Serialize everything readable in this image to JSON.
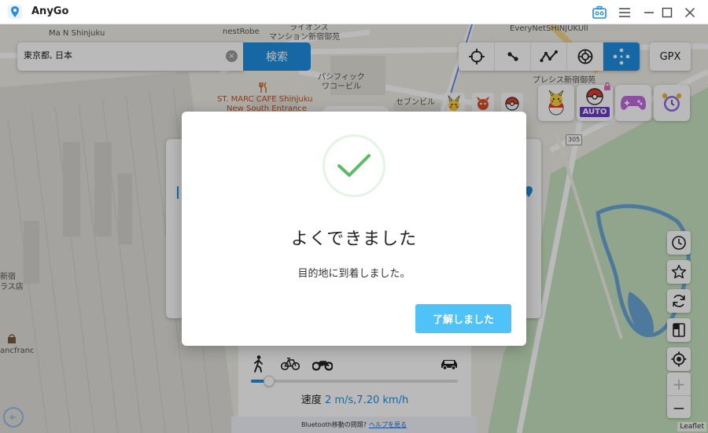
{
  "app": {
    "title": "AnyGo"
  },
  "search": {
    "value": "東京都, 日本",
    "button": "検索"
  },
  "toolbar": {
    "gpx": "GPX"
  },
  "feature_icons": {
    "auto_badge": "AUTO"
  },
  "map": {
    "labels": {
      "label_1": "Ma N Shinjuku",
      "label_2": "nestRobe",
      "label_3": "ライオンズ",
      "label_4": "マンション新宿御苑",
      "label_5": "EveryNetSHINJUKUll",
      "label_6": "パシフィック",
      "label_7": "ワコービル",
      "label_8": "ST. MARC CAFE Shinjuku",
      "label_9": "New South Entrance",
      "label_10": "セブンビル",
      "label_11": "プレシス新宿御苑",
      "label_12": "新宿",
      "label_13": "ラス店",
      "label_14": "ancfranc",
      "road_305": "305"
    },
    "attribution": "Leaflet"
  },
  "speed": {
    "label": "速度",
    "value": "2 m/s,7.20 km/h",
    "level": 0.06
  },
  "bluetooth": {
    "text": "Bluetooth移動の問題?",
    "link": "ヘルプを見る"
  },
  "dialog": {
    "title": "よくできました",
    "message": "目的地に到着しました。",
    "confirm": "了解しました"
  },
  "colors": {
    "accent": "#1d8fe0",
    "success": "#5dbb63",
    "dialog_button": "#4fc3f7"
  }
}
